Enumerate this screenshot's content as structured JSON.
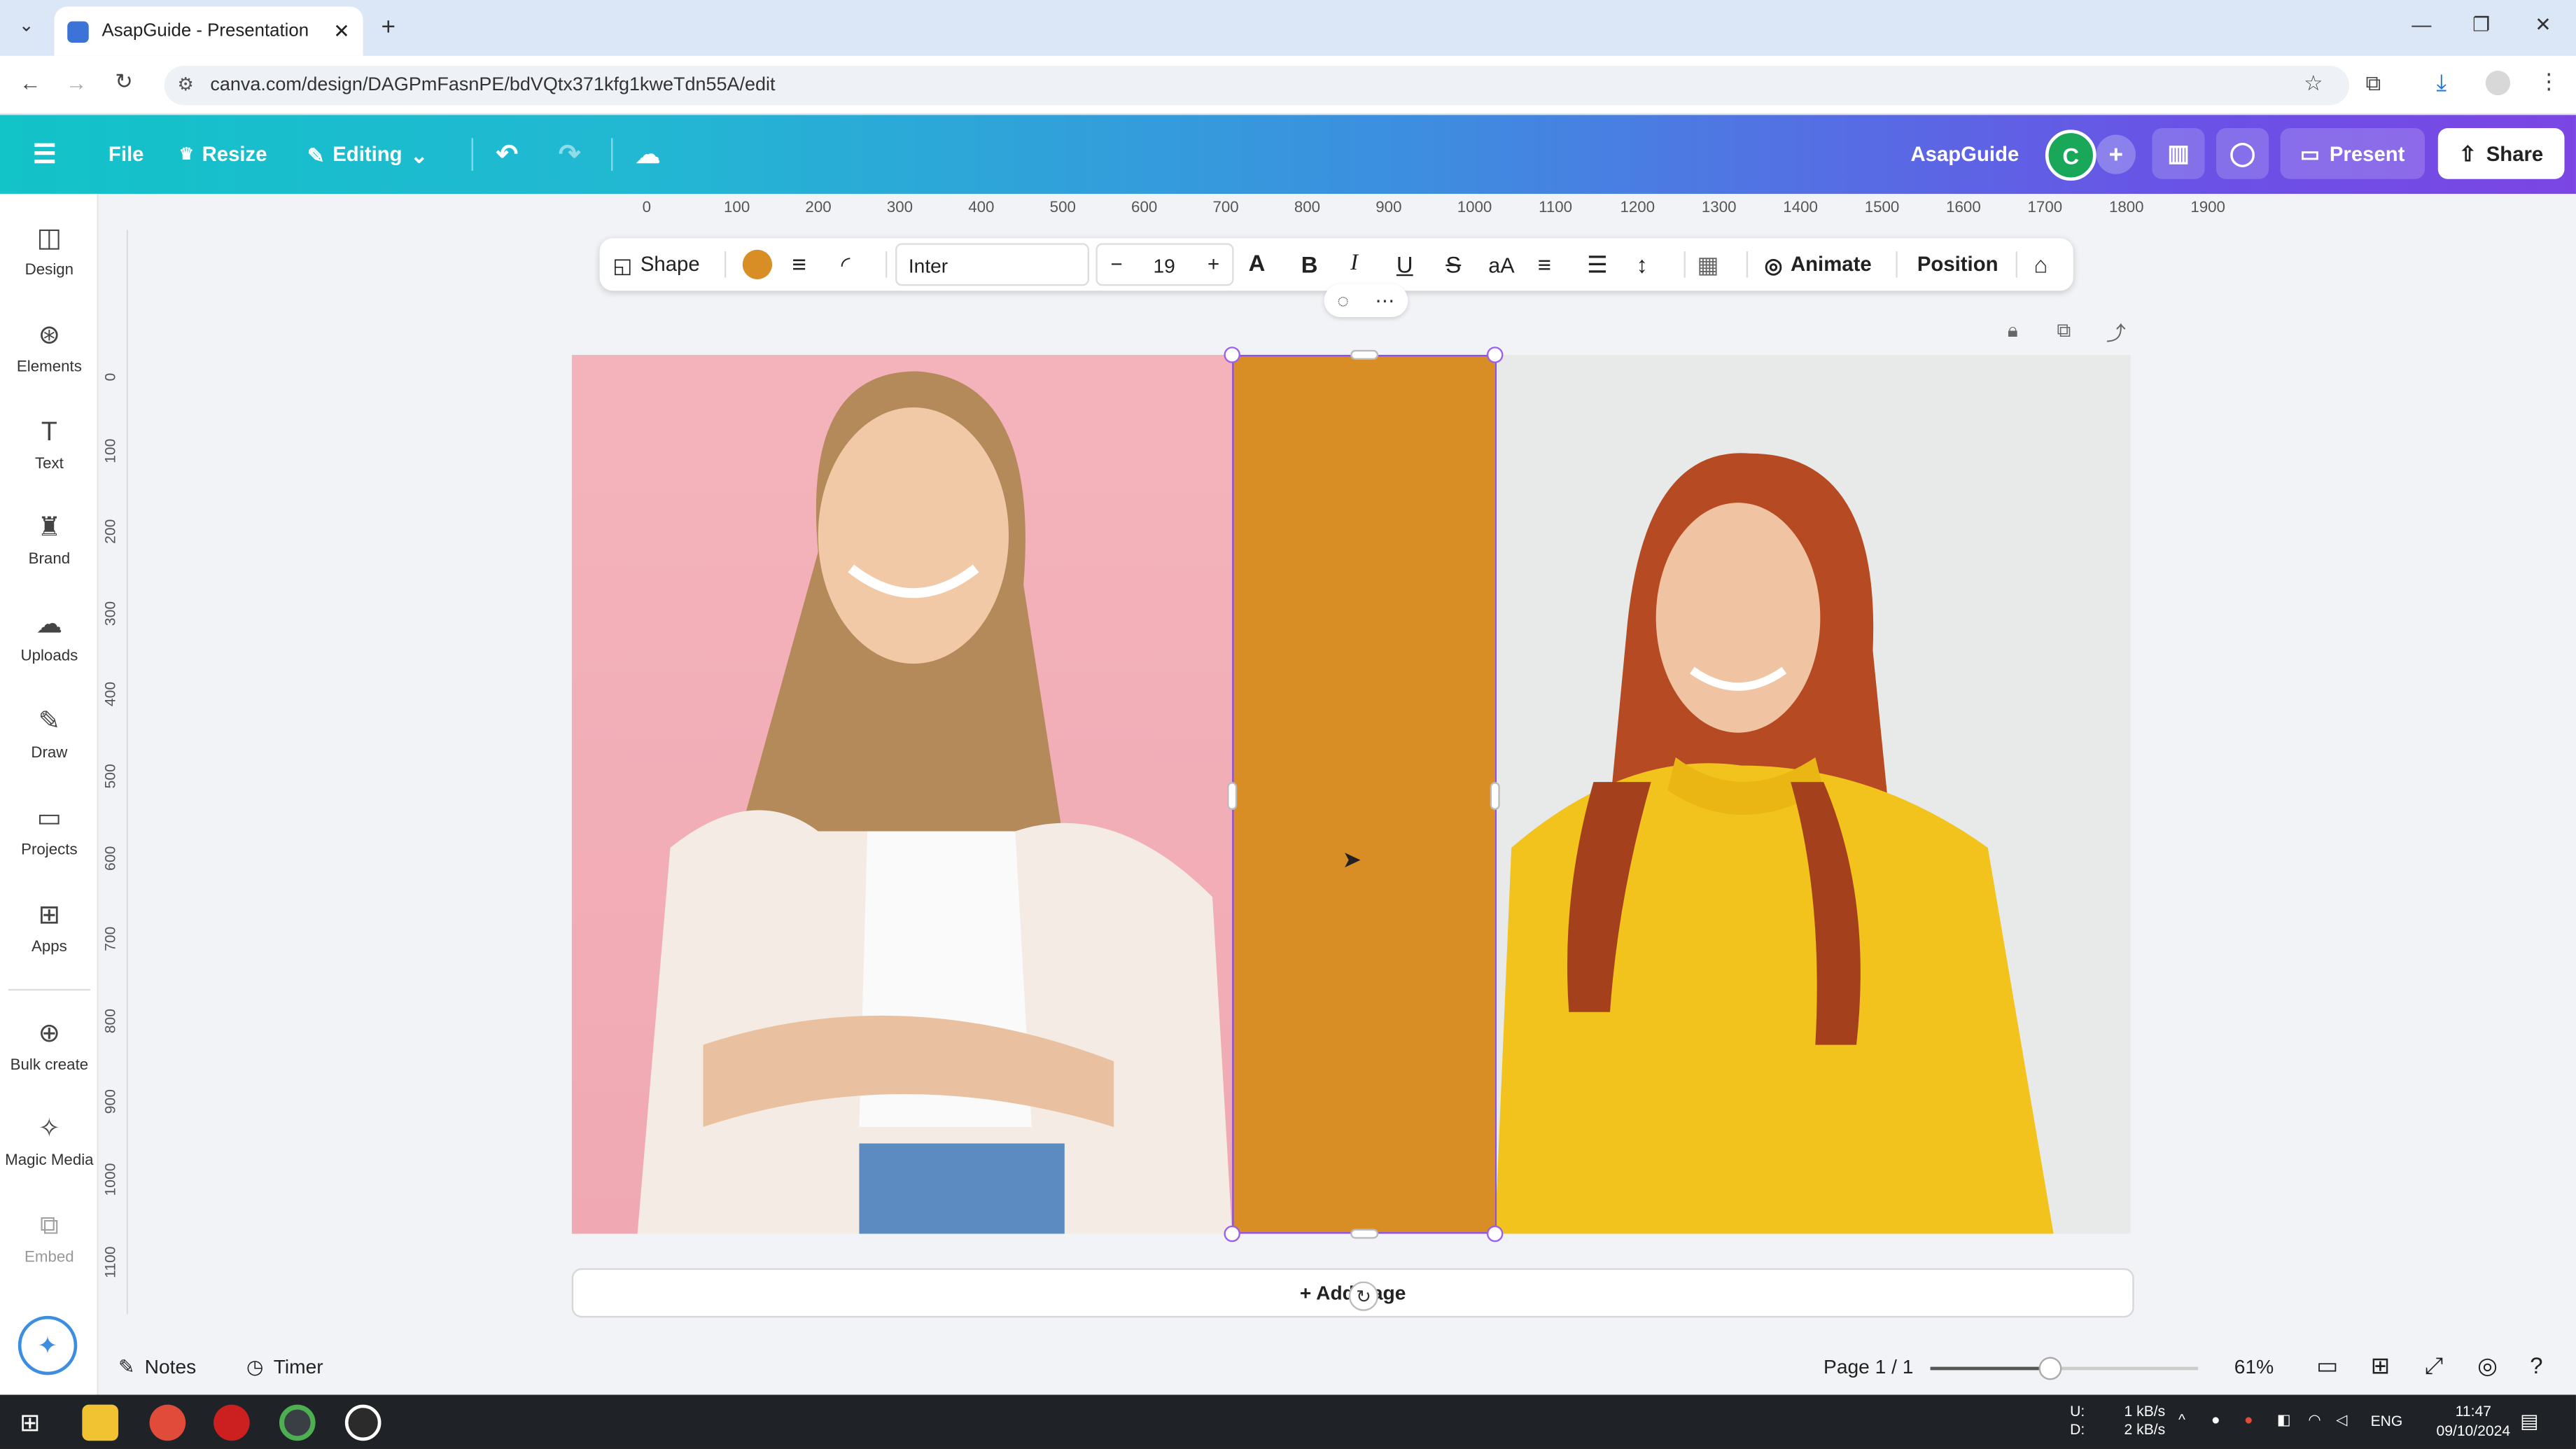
{
  "browser": {
    "tab_title": "AsapGuide - Presentation",
    "url": "canva.com/design/DAGPmFasnPE/bdVQtx371kfg1kweTdn55A/edit",
    "new_tab_icon": "plus-icon"
  },
  "toolbar": {
    "file_label": "File",
    "resize_label": "Resize",
    "editing_label": "Editing",
    "brand_name": "AsapGuide",
    "avatar_letter": "C",
    "present_label": "Present",
    "share_label": "Share"
  },
  "rail": {
    "items": [
      {
        "label": "Design",
        "icon": "design-icon"
      },
      {
        "label": "Elements",
        "icon": "elements-icon"
      },
      {
        "label": "Text",
        "icon": "text-icon"
      },
      {
        "label": "Brand",
        "icon": "brand-icon"
      },
      {
        "label": "Uploads",
        "icon": "uploads-icon"
      },
      {
        "label": "Draw",
        "icon": "draw-icon"
      },
      {
        "label": "Projects",
        "icon": "projects-icon"
      },
      {
        "label": "Apps",
        "icon": "apps-icon"
      },
      {
        "label": "Bulk create",
        "icon": "bulk-create-icon"
      },
      {
        "label": "Magic Media",
        "icon": "magic-media-icon"
      },
      {
        "label": "Embed",
        "icon": "embed-icon"
      }
    ]
  },
  "rulers": {
    "horizontal": [
      "0",
      "100",
      "200",
      "300",
      "400",
      "500",
      "600",
      "700",
      "800",
      "900",
      "1000",
      "1100",
      "1200",
      "1300",
      "1400",
      "1500",
      "1600",
      "1700",
      "1800",
      "1900"
    ],
    "vertical": [
      "0",
      "100",
      "200",
      "300",
      "400",
      "500",
      "600",
      "700",
      "800",
      "900",
      "1000",
      "1100"
    ]
  },
  "element_toolbar": {
    "shape_label": "Shape",
    "fill_color": "#d98d25",
    "font": "Inter",
    "font_size": "19",
    "minus": "−",
    "plus": "+",
    "animate_label": "Animate",
    "position_label": "Position"
  },
  "canvas": {
    "rect_color": "#d98d25",
    "add_page_label": "+ Add page"
  },
  "bottom": {
    "notes_label": "Notes",
    "timer_label": "Timer",
    "page_label": "Page 1 / 1",
    "zoom_label": "61%",
    "zoom_fraction": 0.45
  },
  "taskbar": {
    "network_up": "1 kB/s",
    "network_down": "2 kB/s",
    "ud_up": "U:",
    "ud_down": "D:",
    "lang": "ENG",
    "time": "11:47",
    "date": "09/10/2024"
  }
}
